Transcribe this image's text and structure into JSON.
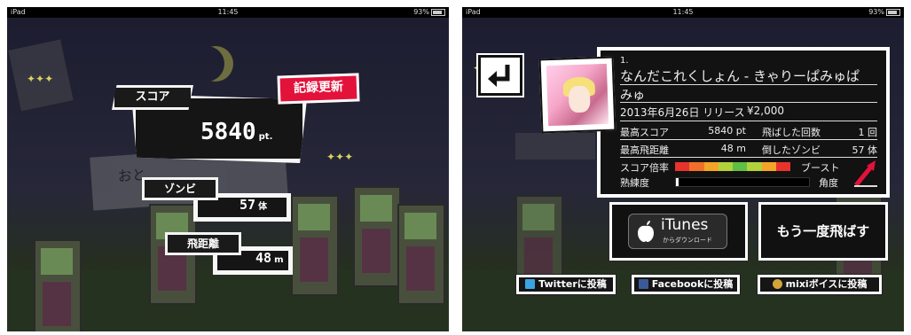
{
  "status_bar": {
    "carrier": "iPad",
    "time": "11:45",
    "battery": "93%"
  },
  "result_screen": {
    "record_badge": "記録更新",
    "score": {
      "label": "スコア",
      "value": "5840",
      "unit": "pt."
    },
    "zombies": {
      "label": "ゾンビ",
      "value": "57",
      "unit": "体"
    },
    "distance": {
      "label": "飛距離",
      "value": "48",
      "unit": "m"
    },
    "background_text": "おと"
  },
  "song_screen": {
    "track_number": "1.",
    "title_line1": "なんだこれくしょん - きゃりーぱみゅぱ",
    "title_line2": "みゅ",
    "release_date": "2013年6月26日 リリース",
    "price": "¥2,000",
    "stats": {
      "best_score_label": "最高スコア",
      "best_score_value": "5840 pt",
      "launch_count_label": "飛ばした回数",
      "launch_count_value": "1 回",
      "best_distance_label": "最高飛距離",
      "best_distance_value": "48 m",
      "defeated_label": "倒したゾンビ",
      "defeated_value": "57 体",
      "multiplier_label": "スコア倍率",
      "boost_label": "ブースト",
      "skill_label": "熟練度",
      "angle_label": "角度"
    },
    "skill_level": 0.02,
    "multiplier_colors": [
      "#e8322e",
      "#f0702a",
      "#f4a527",
      "#b2d23b",
      "#5fbf45",
      "#b2d23b",
      "#f4a527",
      "#e8322e"
    ],
    "accent_red": "#e3123a",
    "itunes_button": {
      "label": "iTunes",
      "sublabel": "からダウンロード"
    },
    "retry_button": "もう一度飛ばす",
    "share_twitter": "Twitterに投稿",
    "share_facebook": "Facebookに投稿",
    "share_mixi": "mixiボイスに投稿"
  }
}
